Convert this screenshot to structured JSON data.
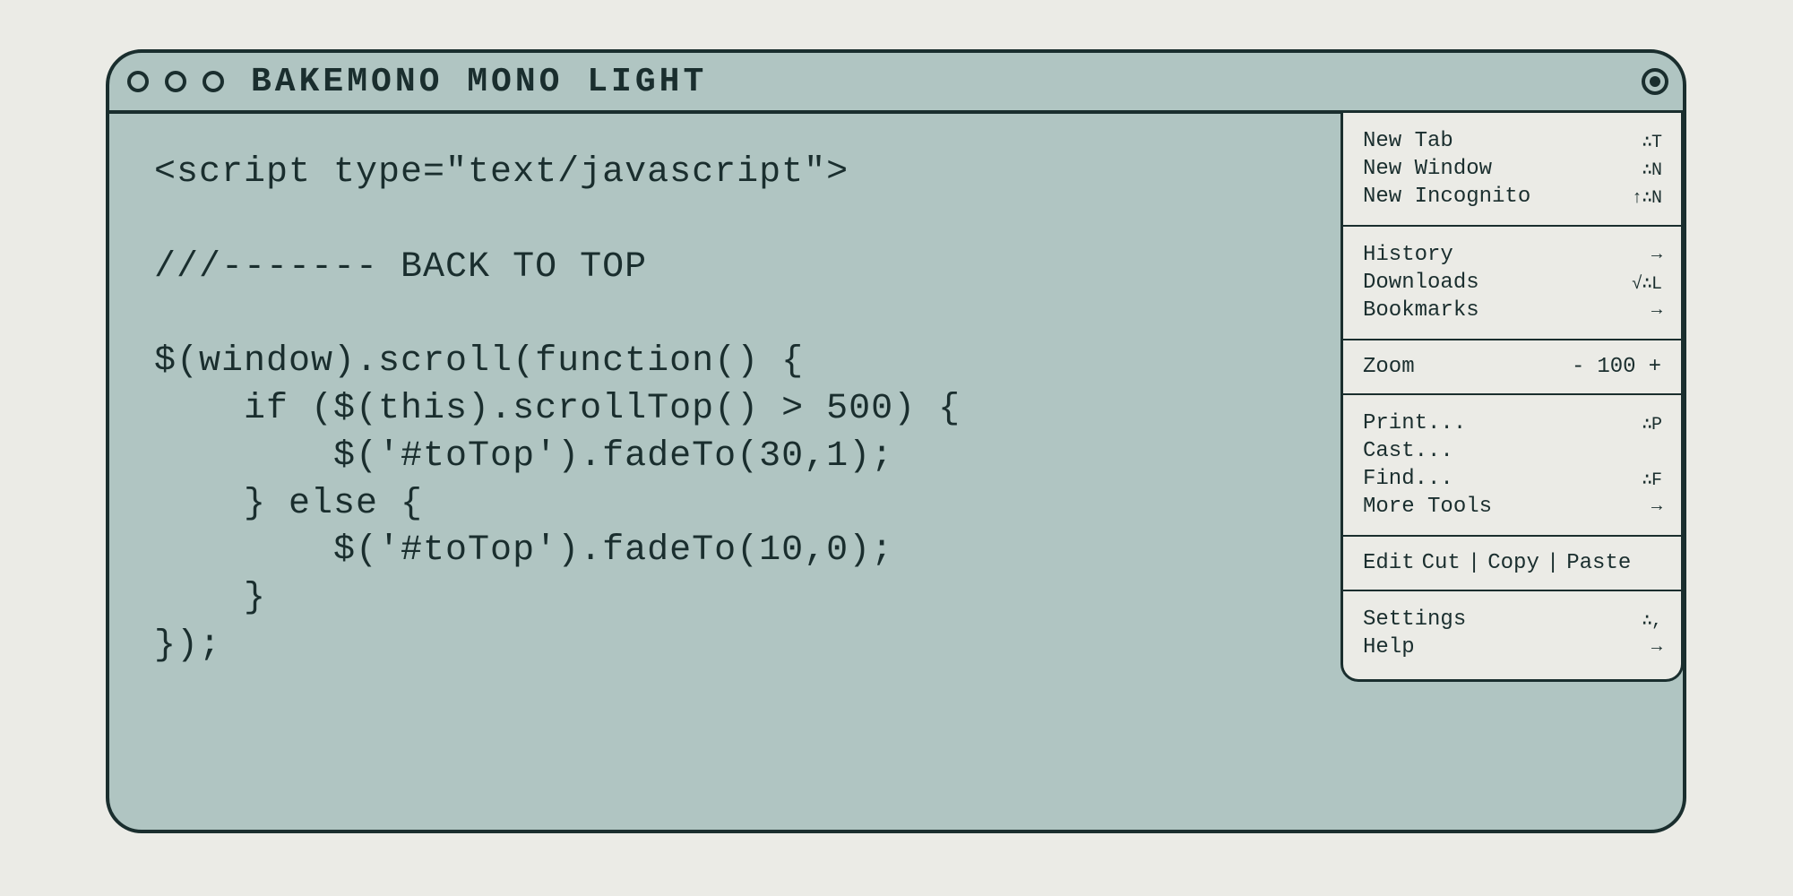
{
  "window": {
    "title": "BAKEMONO MONO LIGHT"
  },
  "code": {
    "line1": "<script type=\"text/javascript\">",
    "line2": "",
    "line3": "///------- BACK TO TOP",
    "line4": "",
    "line5": "$(window).scroll(function() {",
    "line6": "    if ($(this).scrollTop() > 500) {",
    "line7": "        $('#toTop').fadeTo(30,1);",
    "line8": "    } else {",
    "line9": "        $('#toTop').fadeTo(10,0);",
    "line10": "    }",
    "line11": "});"
  },
  "menu": {
    "section1": {
      "new_tab": {
        "label": "New Tab",
        "shortcut": "∴T"
      },
      "new_window": {
        "label": "New Window",
        "shortcut": "∴N"
      },
      "new_incognito": {
        "label": "New Incognito",
        "shortcut": "↑∴N"
      }
    },
    "section2": {
      "history": {
        "label": "History",
        "shortcut": "→"
      },
      "downloads": {
        "label": "Downloads",
        "shortcut": "√∴L"
      },
      "bookmarks": {
        "label": "Bookmarks",
        "shortcut": "→"
      }
    },
    "section3": {
      "zoom_label": "Zoom",
      "zoom_value": "100",
      "zoom_minus": "-",
      "zoom_plus": "+"
    },
    "section4": {
      "print": {
        "label": "Print...",
        "shortcut": "∴P"
      },
      "cast": {
        "label": "Cast...",
        "shortcut": ""
      },
      "find": {
        "label": "Find...",
        "shortcut": "∴F"
      },
      "more_tools": {
        "label": "More Tools",
        "shortcut": "→"
      }
    },
    "section5": {
      "edit": "Edit",
      "cut": "Cut",
      "copy": "Copy",
      "paste": "Paste"
    },
    "section6": {
      "settings": {
        "label": "Settings",
        "shortcut": "∴,"
      },
      "help": {
        "label": "Help",
        "shortcut": "→"
      }
    }
  }
}
